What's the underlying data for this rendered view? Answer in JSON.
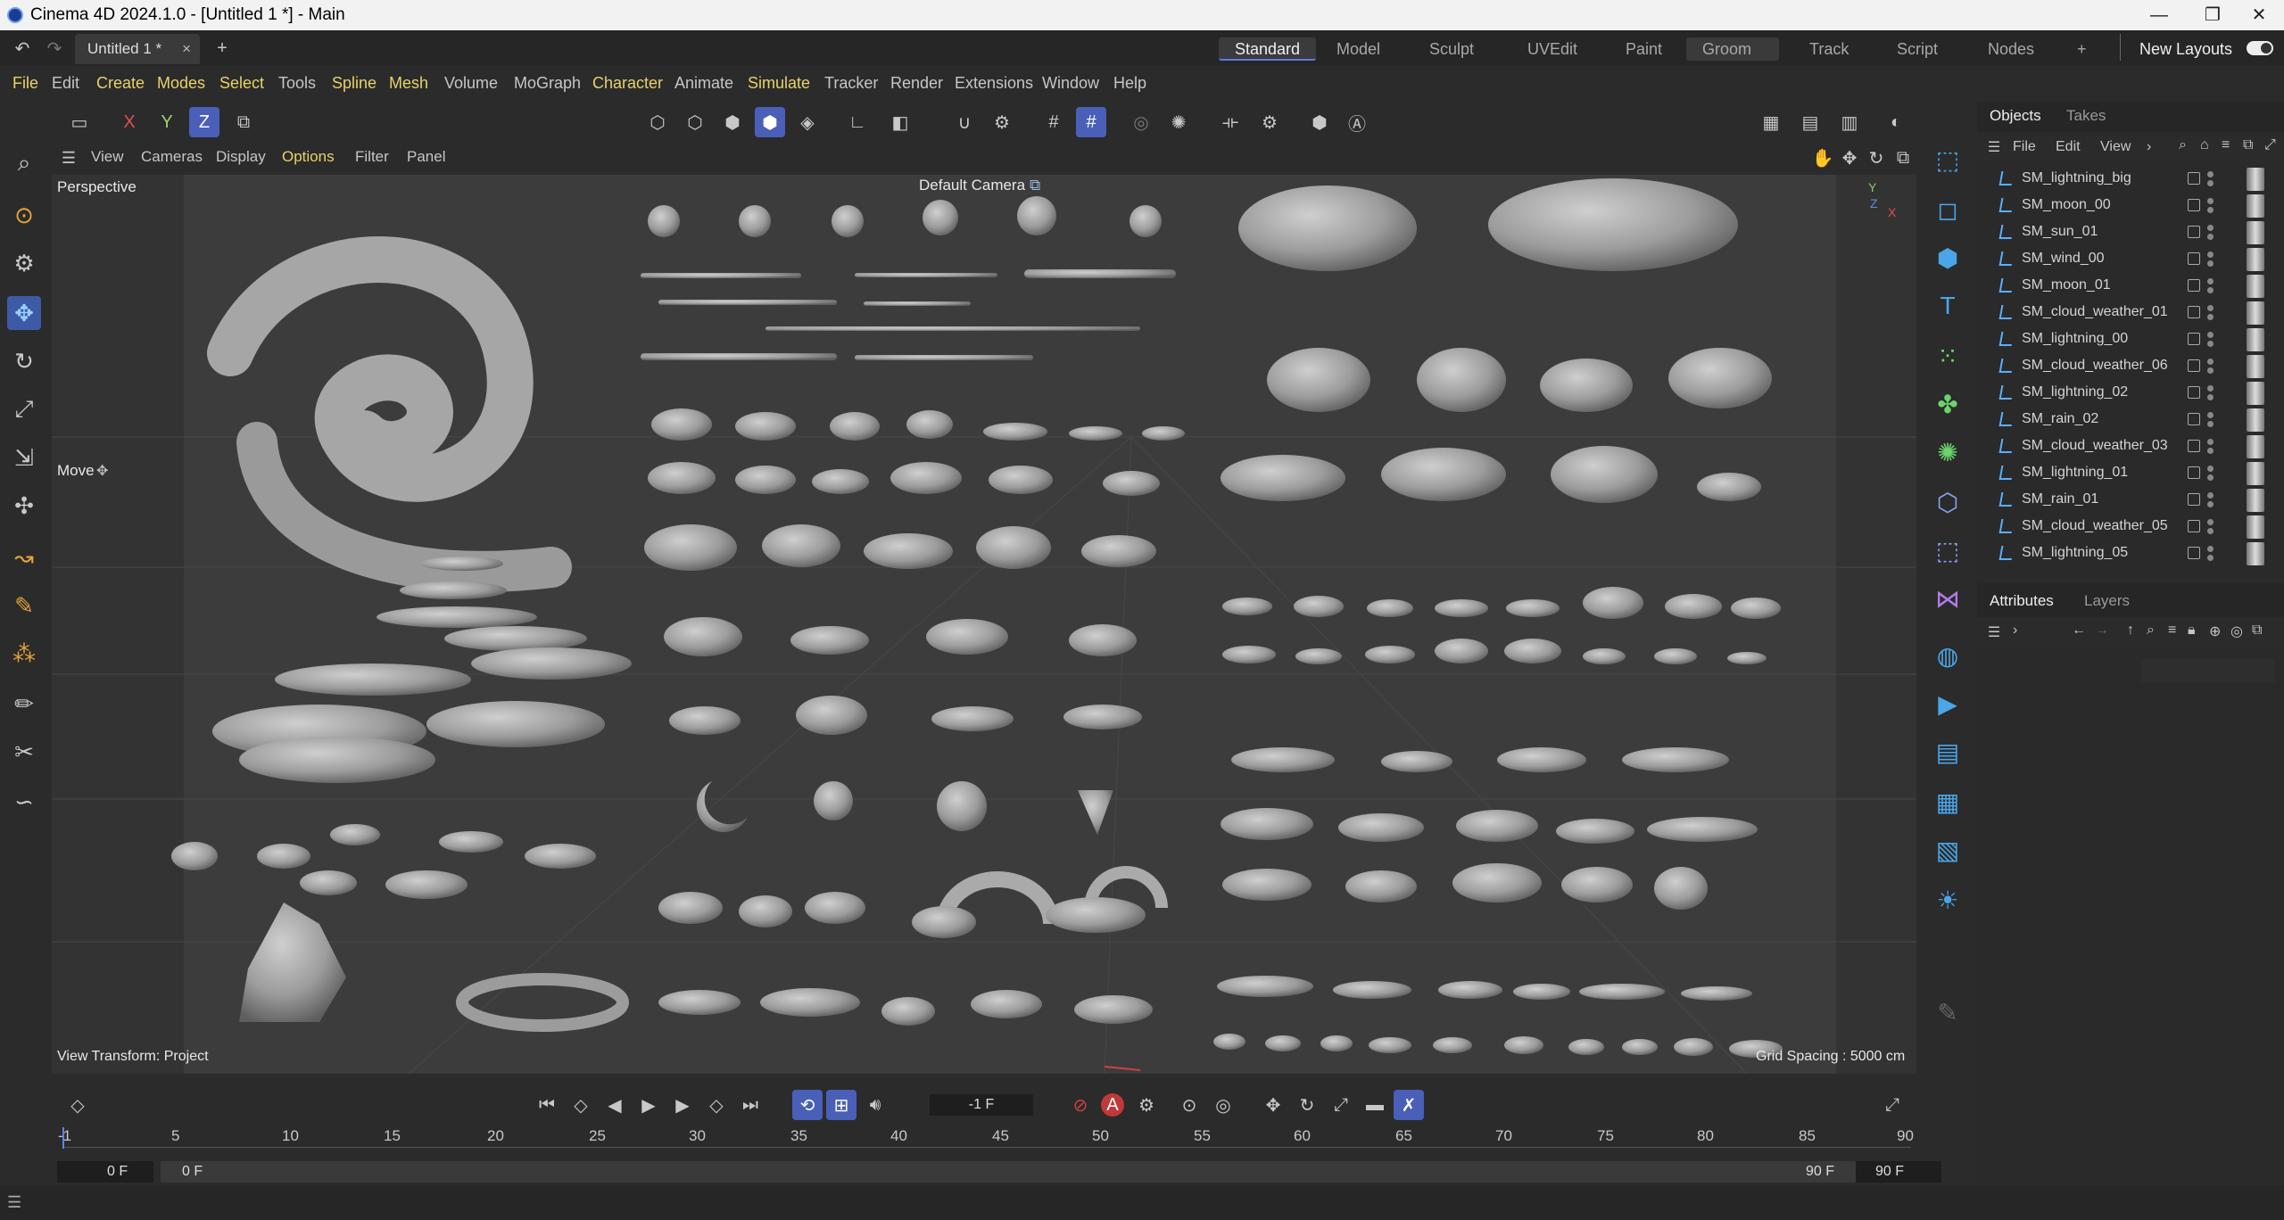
{
  "window": {
    "title": "Cinema 4D 2024.1.0 - [Untitled 1 *] - Main",
    "min": "—",
    "restore": "❐",
    "close": "✕"
  },
  "doc_tab": {
    "label": "Untitled 1 *",
    "close": "×",
    "add": "+"
  },
  "layouts": [
    "Standard",
    "Model",
    "Sculpt",
    "UVEdit",
    "Paint",
    "Groom",
    "Track",
    "Script",
    "Nodes"
  ],
  "layouts_extra": {
    "plus": "+",
    "new_layouts": "New Layouts"
  },
  "menu": [
    "File",
    "Edit",
    "Create",
    "Modes",
    "Select",
    "Tools",
    "Spline",
    "Mesh",
    "Volume",
    "MoGraph",
    "Character",
    "Animate",
    "Simulate",
    "Tracker",
    "Render",
    "Extensions",
    "Window",
    "Help"
  ],
  "axis_buttons": {
    "x": "X",
    "y": "Y",
    "z": "Z"
  },
  "viewport_menu": [
    "View",
    "Cameras",
    "Display",
    "Options",
    "Filter",
    "Panel"
  ],
  "viewport": {
    "name": "Perspective",
    "camera": "Default Camera",
    "tool": "Move",
    "view_transform": "View Transform: Project",
    "grid_spacing": "Grid Spacing : 5000 cm",
    "gizmo": {
      "y": "Y",
      "z": "Z",
      "x": "X"
    }
  },
  "objects_panel": {
    "tabs": [
      "Objects",
      "Takes"
    ],
    "menu": [
      "File",
      "Edit",
      "View"
    ],
    "items": [
      "SM_lightning_big",
      "SM_moon_00",
      "SM_sun_01",
      "SM_wind_00",
      "SM_moon_01",
      "SM_cloud_weather_01",
      "SM_lightning_00",
      "SM_cloud_weather_06",
      "SM_lightning_02",
      "SM_rain_02",
      "SM_cloud_weather_03",
      "SM_lightning_01",
      "SM_rain_01",
      "SM_cloud_weather_05",
      "SM_lightning_05"
    ]
  },
  "attributes_panel": {
    "tabs": [
      "Attributes",
      "Layers"
    ]
  },
  "timeline": {
    "current_frame": "-1 F",
    "ticks": [
      "5",
      "10",
      "15",
      "20",
      "25",
      "30",
      "35",
      "40",
      "45",
      "50",
      "55",
      "60",
      "65",
      "70",
      "75",
      "80",
      "85",
      "90"
    ],
    "start": "0 F",
    "range_start": "0 F",
    "range_end": "90 F",
    "end": "90 F"
  },
  "colors": {
    "accent": "#4a5fb8",
    "menu_highlight": "#e7d26a",
    "bg": "#2b2b2b",
    "viewport": "#3c3c3c"
  }
}
